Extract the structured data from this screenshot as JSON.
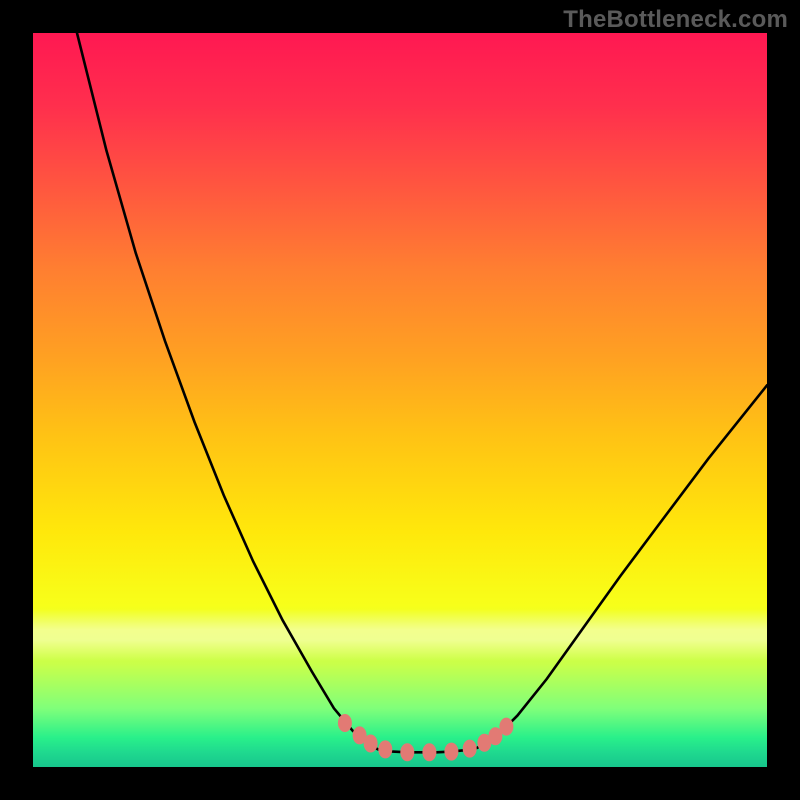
{
  "watermark": "TheBottleneck.com",
  "colors": {
    "frame": "#000000",
    "curve_stroke": "#000000",
    "marker_fill": "#e27a74",
    "gradient_top": "#ff1852",
    "gradient_bottom": "#17c68c"
  },
  "chart_data": {
    "type": "line",
    "title": "",
    "xlabel": "",
    "ylabel": "",
    "xlim": [
      0,
      100
    ],
    "ylim": [
      0,
      100
    ],
    "grid": false,
    "annotations": [],
    "series": [
      {
        "name": "left-branch",
        "x": [
          6,
          8,
          10,
          14,
          18,
          22,
          26,
          30,
          34,
          38,
          41,
          43.5,
          45.5,
          47
        ],
        "y": [
          100,
          92,
          84,
          70,
          58,
          47,
          37,
          28,
          20,
          13,
          8,
          5,
          3.2,
          2.4
        ]
      },
      {
        "name": "flat-bottom",
        "x": [
          47,
          49,
          51,
          53,
          55,
          57,
          59,
          60.5
        ],
        "y": [
          2.4,
          2.1,
          2.0,
          2.0,
          2.0,
          2.1,
          2.3,
          2.6
        ]
      },
      {
        "name": "right-branch",
        "x": [
          60.5,
          63,
          66,
          70,
          75,
          80,
          86,
          92,
          100
        ],
        "y": [
          2.6,
          4.0,
          7.0,
          12,
          19,
          26,
          34,
          42,
          52
        ]
      }
    ],
    "markers": {
      "name": "transition-markers",
      "x": [
        42.5,
        44.5,
        46.0,
        48.0,
        51.0,
        54.0,
        57.0,
        59.5,
        61.5,
        63.0,
        64.5
      ],
      "y": [
        6.0,
        4.3,
        3.2,
        2.4,
        2.0,
        2.0,
        2.1,
        2.5,
        3.3,
        4.2,
        5.5
      ]
    }
  }
}
